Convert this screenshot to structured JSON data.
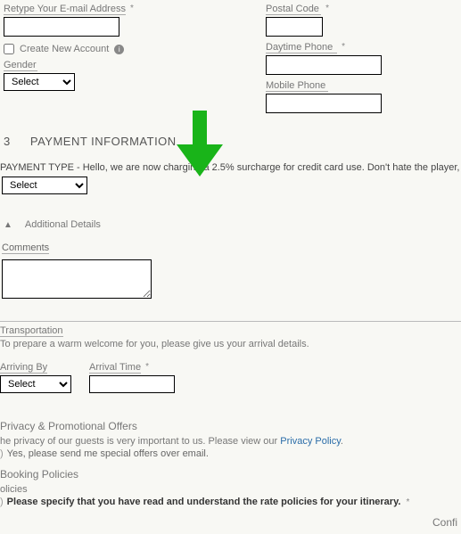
{
  "top": {
    "retype_email_label": "Retype Your E-mail Address",
    "create_new_account_label": "Create New Account",
    "gender_label": "Gender",
    "postal_code_label": "Postal Code",
    "daytime_phone_label": "Daytime Phone",
    "mobile_phone_label": "Mobile Phone",
    "select_option": "Select"
  },
  "payment": {
    "section_num": "3",
    "section_title": "PAYMENT INFORMATION",
    "type_line": "PAYMENT TYPE - Hello, we are now charging a 2.5% surcharge for credit card use. Don't hate the player, hate the game.",
    "select_option": "Select"
  },
  "additional": {
    "header": "Additional Details",
    "comments_label": "Comments",
    "transportation_label": "Transportation",
    "transportation_msg": "To prepare a warm welcome for you, please give us your arrival details.",
    "arriving_by_label": "Arriving By",
    "arrival_time_label": "Arrival Time",
    "select_option": "Select"
  },
  "privacy": {
    "title": "Privacy & Promotional Offers",
    "line1_prefix": "he privacy of our guests is very important to us. Please view our ",
    "link": "Privacy Policy",
    "offers_label": "Yes, please send me special offers over email."
  },
  "booking": {
    "title": "Booking Policies",
    "subhead": "olicies",
    "policy_text": "Please specify that you have read and understand the rate policies for your itinerary."
  },
  "footer": {
    "confi": "Confi"
  }
}
